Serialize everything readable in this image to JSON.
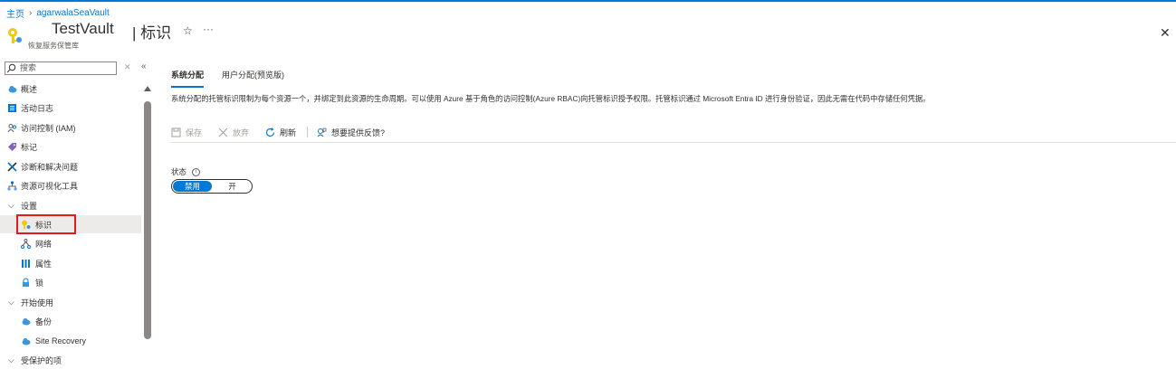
{
  "breadcrumb": {
    "home": "主页",
    "vault": "agarwalaSeaVault"
  },
  "header": {
    "title": "TestVault",
    "section": "| 标识",
    "subtitle": "恢复服务保管库"
  },
  "search": {
    "placeholder": "搜索"
  },
  "nav": {
    "items": [
      {
        "label": "概述"
      },
      {
        "label": "活动日志"
      },
      {
        "label": "访问控制 (IAM)"
      },
      {
        "label": "标记"
      },
      {
        "label": "诊断和解决问题"
      },
      {
        "label": "资源可视化工具"
      },
      {
        "label": "设置"
      },
      {
        "label": "标识"
      },
      {
        "label": "网络"
      },
      {
        "label": "属性"
      },
      {
        "label": "锁"
      },
      {
        "label": "开始使用"
      },
      {
        "label": "备份"
      },
      {
        "label": "Site Recovery"
      },
      {
        "label": "受保护的项"
      }
    ]
  },
  "tabs": [
    {
      "label": "系统分配"
    },
    {
      "label": "用户分配(预览版)"
    }
  ],
  "description": "系统分配的托管标识限制为每个资源一个，并绑定到此资源的生命周期。可以使用 Azure 基于角色的访问控制(Azure RBAC)向托管标识授予权限。托管标识通过 Microsoft Entra ID 进行身份验证，因此无需在代码中存储任何凭据。",
  "toolbar": {
    "save": "保存",
    "discard": "放弃",
    "refresh": "刷新",
    "feedback": "想要提供反馈?"
  },
  "status": {
    "label": "状态",
    "off": "禁用",
    "on": "开"
  },
  "colors": {
    "accent": "#0078d4",
    "highlight": "#e01b1b"
  }
}
